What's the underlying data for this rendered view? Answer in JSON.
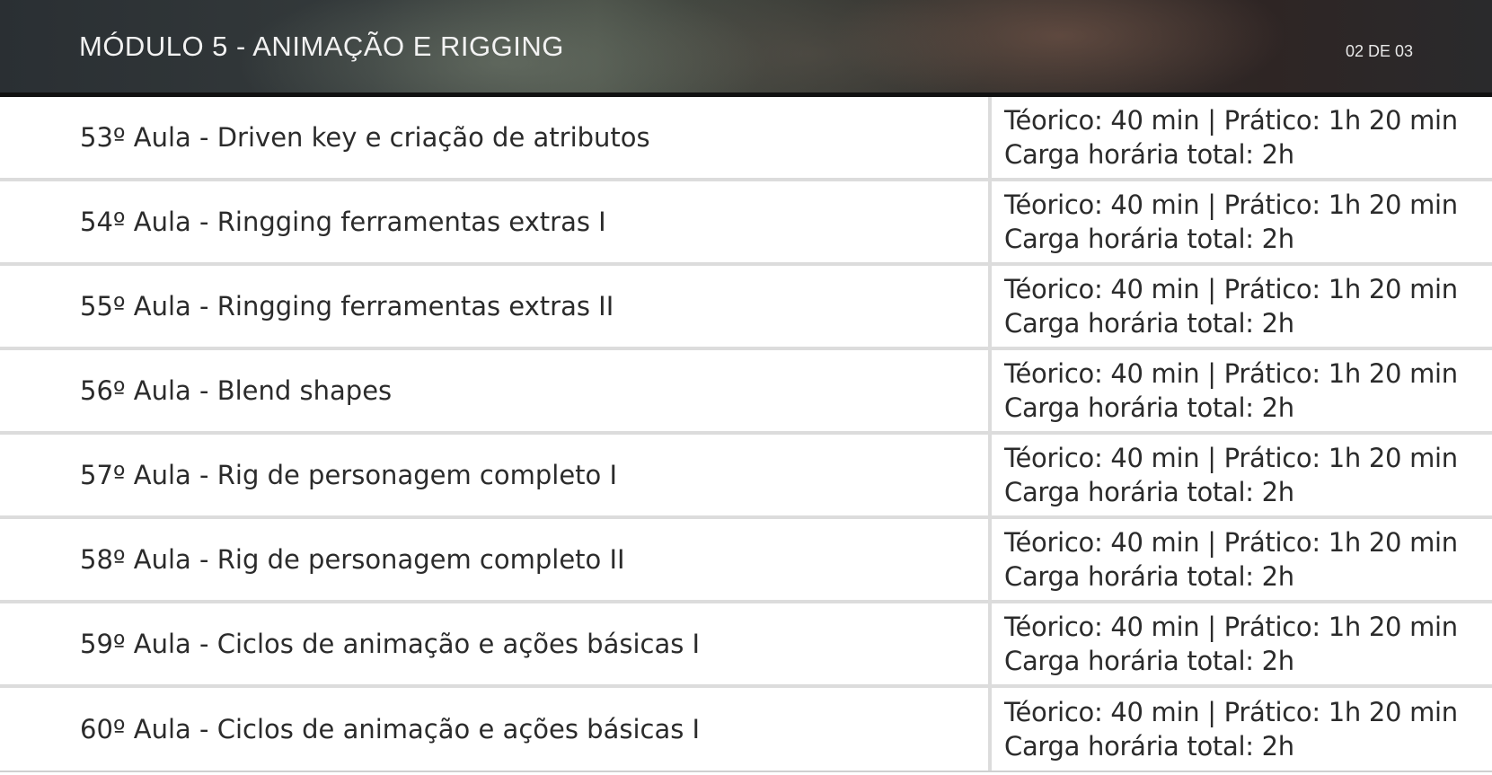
{
  "header": {
    "title": "MÓDULO 5 - ANIMAÇÃO E RIGGING",
    "page_indicator": "02 DE 03"
  },
  "lessons": [
    {
      "title": "53º Aula - Driven key e criação de atributos",
      "time_line1": "Téorico: 40 min | Prático: 1h 20 min",
      "time_line2": "Carga horária total: 2h"
    },
    {
      "title": "54º Aula - Ringging ferramentas extras I",
      "time_line1": "Téorico: 40 min | Prático: 1h 20 min",
      "time_line2": "Carga horária total: 2h"
    },
    {
      "title": "55º Aula - Ringging ferramentas extras II",
      "time_line1": "Téorico: 40 min | Prático: 1h 20 min",
      "time_line2": "Carga horária total: 2h"
    },
    {
      "title": "56º Aula - Blend shapes",
      "time_line1": "Téorico: 40 min | Prático: 1h 20 min",
      "time_line2": "Carga horária total: 2h"
    },
    {
      "title": "57º Aula - Rig de personagem completo I",
      "time_line1": "Téorico: 40 min | Prático: 1h 20 min",
      "time_line2": "Carga horária total: 2h"
    },
    {
      "title": "58º Aula - Rig de personagem completo II",
      "time_line1": "Téorico: 40 min | Prático: 1h 20 min",
      "time_line2": "Carga horária total: 2h"
    },
    {
      "title": "59º Aula - Ciclos de animação e ações básicas I",
      "time_line1": "Téorico: 40 min | Prático: 1h 20 min",
      "time_line2": "Carga horária total: 2h"
    },
    {
      "title": "60º Aula - Ciclos de animação e ações básicas I",
      "time_line1": "Téorico: 40 min | Prático: 1h 20 min",
      "time_line2": "Carga horária total: 2h"
    }
  ]
}
